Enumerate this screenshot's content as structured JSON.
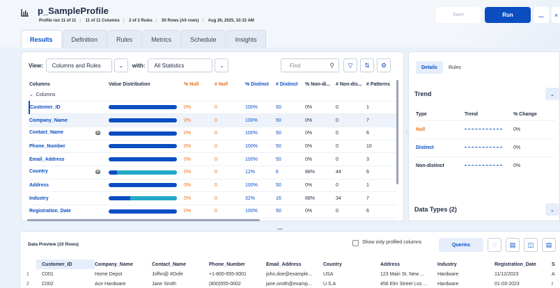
{
  "header": {
    "title": "p_SampleProfile",
    "meta": [
      "Profile run 11 of 11",
      "11 of 11 Columns",
      "2 of 2 Rules",
      "50 Rows (All rows)",
      "Aug 26, 2025, 10:15 AM"
    ],
    "save_label": "Save",
    "run_label": "Run",
    "more_label": "...",
    "close_label": "×"
  },
  "tabs": [
    "Results",
    "Definition",
    "Rules",
    "Metrics",
    "Schedule",
    "Insights"
  ],
  "toolbar": {
    "view_label": "View:",
    "view_value": "Columns and Rules",
    "with_label": "with:",
    "with_value": "All Statistics",
    "find_placeholder": "Find"
  },
  "profile_table": {
    "headers": [
      "Columns",
      "Value Distribution",
      "% Null",
      "# Null",
      "% Distinct",
      "# Distinct",
      "% Non-di...",
      "# Non-dis...",
      "# Patterns"
    ],
    "group": "Columns",
    "rows": [
      {
        "name": "Customer_ID",
        "pct_null": "0%",
        "num_null": "0",
        "pct_distinct": "100%",
        "num_distinct": "50",
        "pct_nondistinct": "0%",
        "num_nondistinct": "0",
        "patterns": "1",
        "dist_fraction": 1.0
      },
      {
        "name": "Company_Name",
        "pct_null": "0%",
        "num_null": "0",
        "pct_distinct": "100%",
        "num_distinct": "50",
        "pct_nondistinct": "0%",
        "num_nondistinct": "0",
        "patterns": "7",
        "dist_fraction": 1.0
      },
      {
        "name": "Contact_Name",
        "pct_null": "0%",
        "num_null": "0",
        "pct_distinct": "100%",
        "num_distinct": "50",
        "pct_nondistinct": "0%",
        "num_nondistinct": "0",
        "patterns": "6",
        "dist_fraction": 1.0,
        "icon": "rule-icon"
      },
      {
        "name": "Phone_Number",
        "pct_null": "0%",
        "num_null": "0",
        "pct_distinct": "100%",
        "num_distinct": "50",
        "pct_nondistinct": "0%",
        "num_nondistinct": "0",
        "patterns": "10",
        "dist_fraction": 1.0
      },
      {
        "name": "Email_Address",
        "pct_null": "0%",
        "num_null": "0",
        "pct_distinct": "100%",
        "num_distinct": "50",
        "pct_nondistinct": "0%",
        "num_nondistinct": "0",
        "patterns": "3",
        "dist_fraction": 1.0
      },
      {
        "name": "Country",
        "pct_null": "0%",
        "num_null": "0",
        "pct_distinct": "12%",
        "num_distinct": "6",
        "pct_nondistinct": "88%",
        "num_nondistinct": "44",
        "patterns": "6",
        "dist_fraction": 0.12,
        "icon": "rule-icon"
      },
      {
        "name": "Address",
        "pct_null": "0%",
        "num_null": "0",
        "pct_distinct": "100%",
        "num_distinct": "50",
        "pct_nondistinct": "0%",
        "num_nondistinct": "0",
        "patterns": "1",
        "dist_fraction": 1.0
      },
      {
        "name": "Industry",
        "pct_null": "0%",
        "num_null": "0",
        "pct_distinct": "32%",
        "num_distinct": "16",
        "pct_nondistinct": "68%",
        "num_nondistinct": "34",
        "patterns": "7",
        "dist_fraction": 0.32
      },
      {
        "name": "Registration_Date",
        "pct_null": "0%",
        "num_null": "0",
        "pct_distinct": "100%",
        "num_distinct": "50",
        "pct_nondistinct": "0%",
        "num_nondistinct": "0",
        "patterns": "6",
        "dist_fraction": 1.0
      }
    ]
  },
  "details": {
    "tabs": [
      "Details",
      "Rules"
    ],
    "trend_title": "Trend",
    "trend_headers": [
      "Type",
      "Trend",
      "% Change"
    ],
    "trend_rows": [
      {
        "type": "Null",
        "change": "0%"
      },
      {
        "type": "Distinct",
        "change": "0%"
      },
      {
        "type": "Non-distinct",
        "change": "0%"
      }
    ],
    "datatypes_title": "Data Types (2)"
  },
  "data_preview": {
    "title": "Data Preview (10 Rows)",
    "show_only_label": "Show only profiled columns",
    "queries_label": "Queries",
    "headers": [
      "",
      "Customer_ID",
      "Company_Name",
      "Contact_Name",
      "Phone_Number",
      "Email_Address",
      "Country",
      "Address",
      "Industry",
      "Registration_Date",
      "S"
    ],
    "rows": [
      [
        "1",
        "C001",
        "Home Depot",
        "Jofhn@ #Dofe",
        "+1-800-555-0001",
        "john.doe@example...",
        "USA",
        "123 Main St. New ...",
        "Hardware",
        "11/12/2023",
        "A"
      ],
      [
        "2",
        "C002",
        "Ace Hardware",
        "Jane Smith",
        "(800)555-0002",
        "jane.smith@examp...",
        "U.S.A",
        "456 Elm Street Los ...",
        "Hardware",
        "01-03-2023",
        "I"
      ]
    ]
  },
  "colors": {
    "accent": "#0a4ec2",
    "orange": "#e8711a",
    "teal": "#23a9c6"
  }
}
